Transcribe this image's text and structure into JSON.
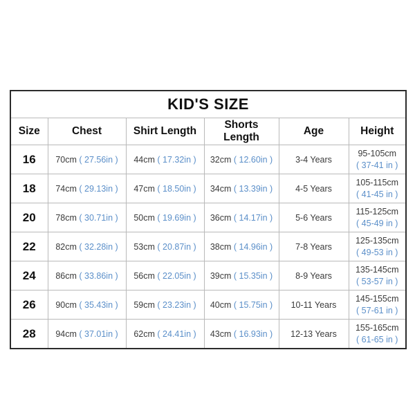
{
  "table": {
    "title": "KID'S SIZE",
    "columns": [
      {
        "key": "size",
        "label": "Size"
      },
      {
        "key": "chest",
        "label": "Chest"
      },
      {
        "key": "shirt",
        "label": "Shirt Length"
      },
      {
        "key": "shorts",
        "label": "Shorts Length"
      },
      {
        "key": "age",
        "label": "Age"
      },
      {
        "key": "height",
        "label": "Height"
      }
    ],
    "colors": {
      "text": "#3a3a3a",
      "heading": "#111111",
      "inch_blue": "#5b8fc9",
      "border": "#b9b9b9",
      "outer_border": "#2b2b2b",
      "background": "#ffffff"
    },
    "rows": [
      {
        "size": "16",
        "chest_cm": "70cm",
        "chest_in": "( 27.56in )",
        "shirt_cm": "44cm",
        "shirt_in": "( 17.32in )",
        "shorts_cm": "32cm",
        "shorts_in": "( 12.60in )",
        "age": "3-4 Years",
        "height_cm": "95-105cm",
        "height_in": "( 37-41 in )"
      },
      {
        "size": "18",
        "chest_cm": "74cm",
        "chest_in": "( 29.13in )",
        "shirt_cm": "47cm",
        "shirt_in": "( 18.50in )",
        "shorts_cm": "34cm",
        "shorts_in": "( 13.39in )",
        "age": "4-5 Years",
        "height_cm": "105-115cm",
        "height_in": "( 41-45 in )"
      },
      {
        "size": "20",
        "chest_cm": "78cm",
        "chest_in": "( 30.71in )",
        "shirt_cm": "50cm",
        "shirt_in": "( 19.69in )",
        "shorts_cm": "36cm",
        "shorts_in": "( 14.17in )",
        "age": "5-6 Years",
        "height_cm": "115-125cm",
        "height_in": "( 45-49 in )"
      },
      {
        "size": "22",
        "chest_cm": "82cm",
        "chest_in": "( 32.28in )",
        "shirt_cm": "53cm",
        "shirt_in": "( 20.87in )",
        "shorts_cm": "38cm",
        "shorts_in": "( 14.96in )",
        "age": "7-8 Years",
        "height_cm": "125-135cm",
        "height_in": "( 49-53 in )"
      },
      {
        "size": "24",
        "chest_cm": "86cm",
        "chest_in": "( 33.86in )",
        "shirt_cm": "56cm",
        "shirt_in": "( 22.05in )",
        "shorts_cm": "39cm",
        "shorts_in": "( 15.35in )",
        "age": "8-9 Years",
        "height_cm": "135-145cm",
        "height_in": "( 53-57 in )"
      },
      {
        "size": "26",
        "chest_cm": "90cm",
        "chest_in": "( 35.43in )",
        "shirt_cm": "59cm",
        "shirt_in": "( 23.23in )",
        "shorts_cm": "40cm",
        "shorts_in": "( 15.75in )",
        "age": "10-11 Years",
        "height_cm": "145-155cm",
        "height_in": "( 57-61 in )"
      },
      {
        "size": "28",
        "chest_cm": "94cm",
        "chest_in": "( 37.01in )",
        "shirt_cm": "62cm",
        "shirt_in": "( 24.41in )",
        "shorts_cm": "43cm",
        "shorts_in": "( 16.93in )",
        "age": "12-13 Years",
        "height_cm": "155-165cm",
        "height_in": "( 61-65 in )"
      }
    ]
  }
}
